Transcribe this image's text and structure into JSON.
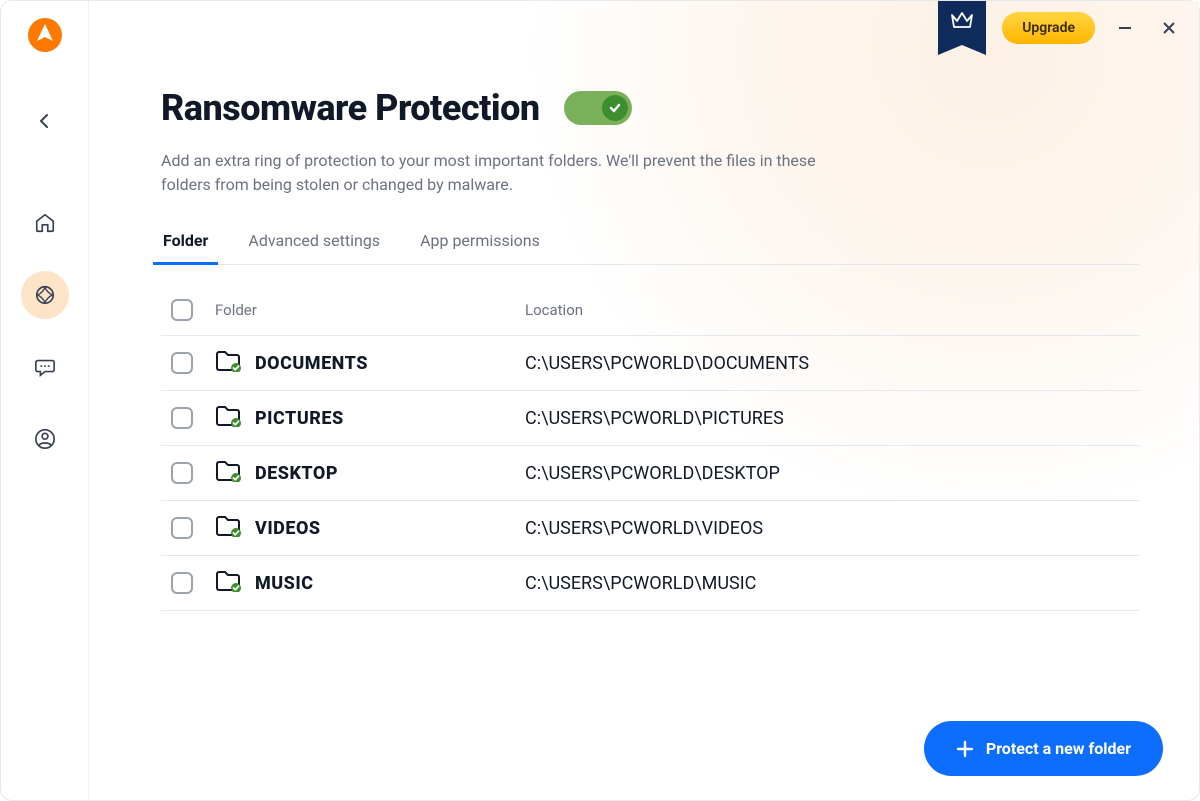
{
  "titlebar": {
    "upgrade_label": "Upgrade"
  },
  "page": {
    "title": "Ransomware Protection",
    "subtitle": "Add an extra ring of protection to your most important folders. We'll prevent the files in these folders from being stolen or changed by malware.",
    "toggle_on": true
  },
  "tabs": [
    {
      "label": "Folder",
      "active": true
    },
    {
      "label": "Advanced settings",
      "active": false
    },
    {
      "label": "App permissions",
      "active": false
    }
  ],
  "table": {
    "headers": {
      "folder": "Folder",
      "location": "Location"
    },
    "rows": [
      {
        "name": "DOCUMENTS",
        "location": "C:\\USERS\\PCWORLD\\DOCUMENTS"
      },
      {
        "name": "PICTURES",
        "location": "C:\\USERS\\PCWORLD\\PICTURES"
      },
      {
        "name": "DESKTOP",
        "location": "C:\\USERS\\PCWORLD\\DESKTOP"
      },
      {
        "name": "VIDEOS",
        "location": "C:\\USERS\\PCWORLD\\VIDEOS"
      },
      {
        "name": "MUSIC",
        "location": "C:\\USERS\\PCWORLD\\MUSIC"
      }
    ]
  },
  "actions": {
    "protect_new_folder": "Protect a new folder"
  },
  "icons": {
    "logo": "avast-logo",
    "back": "chevron-left",
    "crown": "crown-icon",
    "minimize": "minimize-icon",
    "close": "close-icon",
    "plus": "plus-icon",
    "folder_protected": "folder-shield-icon"
  },
  "sidebar_nav": [
    {
      "id": "home",
      "icon": "home-icon",
      "active": false
    },
    {
      "id": "explore",
      "icon": "compass-icon",
      "active": true
    },
    {
      "id": "messages",
      "icon": "chat-icon",
      "active": false
    },
    {
      "id": "account",
      "icon": "user-icon",
      "active": false
    }
  ]
}
